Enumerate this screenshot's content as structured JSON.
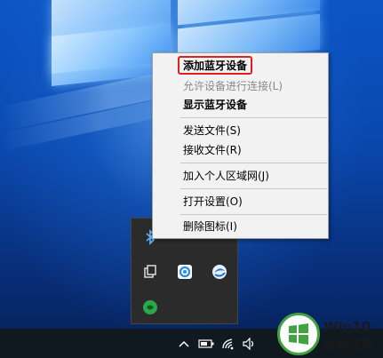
{
  "context_menu": {
    "items": [
      {
        "label": "添加蓝牙设备",
        "style": "bold",
        "highlighted": true
      },
      {
        "label": "允许设备进行连接(L)",
        "style": "disabled"
      },
      {
        "label": "显示蓝牙设备",
        "style": "bold"
      },
      {
        "label": "发送文件(S)",
        "style": "normal"
      },
      {
        "label": "接收文件(R)",
        "style": "normal"
      },
      {
        "label": "加入个人区域网(J)",
        "style": "normal"
      },
      {
        "label": "打开设置(O)",
        "style": "normal"
      },
      {
        "label": "删除图标(I)",
        "style": "normal"
      }
    ],
    "highlight_color": "#e02020"
  },
  "tray_flyout": {
    "icons": [
      "bluetooth-icon",
      "tray-app-icon-1",
      "tray-app-icon-2",
      "tray-app-icon-3",
      "tray-app-icon-4",
      "tray-app-icon-5",
      "tray-app-icon-6"
    ]
  },
  "taskbar": {
    "icons": [
      "show-hidden-icons-chevron",
      "battery-icon",
      "wifi-icon",
      "volume-icon"
    ]
  },
  "watermark": {
    "line1": "Win10",
    "line2": "系统之家"
  },
  "colors": {
    "menu_background": "#f2f2f2",
    "tray_background": "#2b2b2b",
    "taskbar_background": "#101820",
    "watermark_green": "#43a343"
  }
}
